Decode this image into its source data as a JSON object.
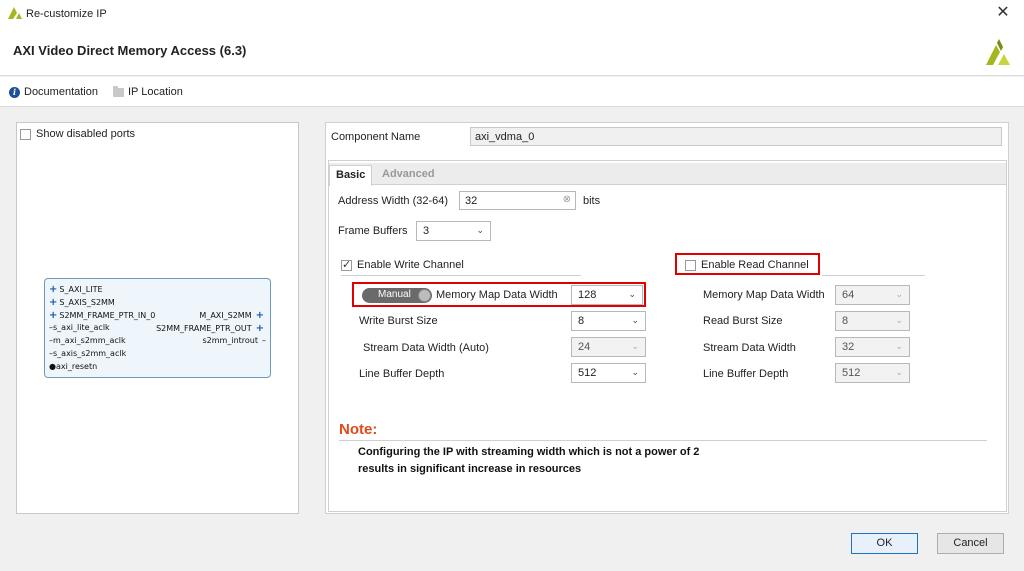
{
  "window": {
    "title": "Re-customize IP",
    "close_glyph": "✕"
  },
  "header": {
    "title": "AXI Video Direct Memory Access (6.3)"
  },
  "links": {
    "documentation": "Documentation",
    "ip_location": "IP Location"
  },
  "left_panel": {
    "show_disabled_ports": "Show disabled ports",
    "block": {
      "left_ports": [
        "S_AXI_LITE",
        "S_AXIS_S2MM",
        "S2MM_FRAME_PTR_IN_0",
        "s_axi_lite_aclk",
        "m_axi_s2mm_aclk",
        "s_axis_s2mm_aclk",
        "axi_resetn"
      ],
      "right_ports": [
        "M_AXI_S2MM",
        "S2MM_FRAME_PTR_OUT",
        "s2mm_introut"
      ]
    }
  },
  "component_name": {
    "label": "Component Name",
    "value": "axi_vdma_0"
  },
  "tabs": {
    "basic": "Basic",
    "advanced": "Advanced"
  },
  "basic": {
    "address_width_label": "Address Width (32-64)",
    "address_width_value": "32",
    "address_width_unit": "bits",
    "frame_buffers_label": "Frame Buffers",
    "frame_buffers_value": "3",
    "enable_write_channel": "Enable Write Channel",
    "enable_read_channel": "Enable Read Channel",
    "write": {
      "toggle_label": "Manual",
      "mm_data_width_label": "Memory Map Data Width",
      "mm_data_width_value": "128",
      "burst_size_label": "Write Burst Size",
      "burst_size_value": "8",
      "stream_width_label": "Stream Data Width (Auto)",
      "stream_width_value": "24",
      "line_buffer_label": "Line Buffer Depth",
      "line_buffer_value": "512"
    },
    "read": {
      "mm_data_width_label": "Memory Map Data Width",
      "mm_data_width_value": "64",
      "burst_size_label": "Read Burst Size",
      "burst_size_value": "8",
      "stream_width_label": "Stream Data Width",
      "stream_width_value": "32",
      "line_buffer_label": "Line Buffer Depth",
      "line_buffer_value": "512"
    },
    "note_title": "Note:",
    "note_line1": "Configuring the IP with streaming width which is not a power of 2",
    "note_line2": "results in significant increase in resources"
  },
  "buttons": {
    "ok": "OK",
    "cancel": "Cancel"
  },
  "colors": {
    "accent": "#1a73c7",
    "highlight": "#e00000",
    "note": "#e04a1a",
    "logo_green": "#a6b61f"
  }
}
